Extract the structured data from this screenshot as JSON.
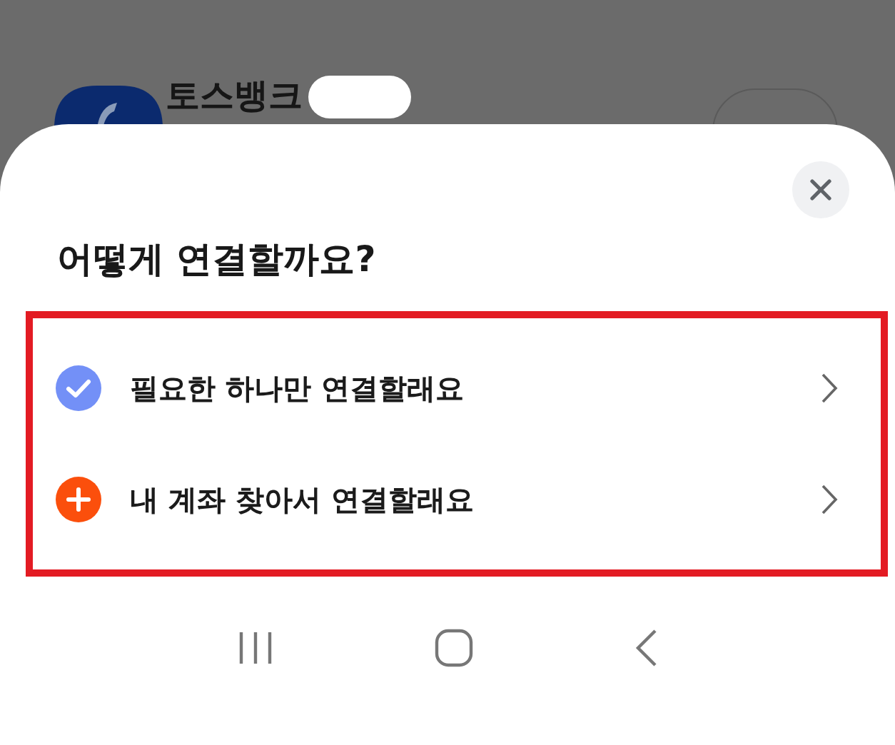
{
  "background": {
    "app_name": "토스뱅크"
  },
  "sheet": {
    "title": "어떻게 연결할까요?",
    "options": [
      {
        "kind": "check",
        "label": "필요한 하나만 연결할래요",
        "color": "#7390f7"
      },
      {
        "kind": "plus",
        "label": "내 계좌 찾아서 연결할래요",
        "color": "#fb4f0c"
      }
    ]
  }
}
